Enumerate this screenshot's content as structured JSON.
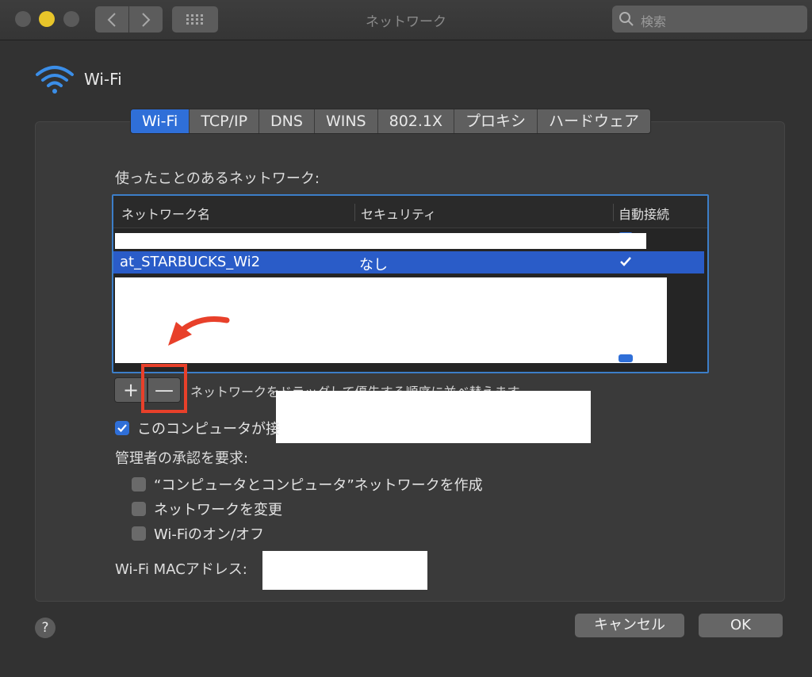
{
  "window": {
    "title": "ネットワーク",
    "search_placeholder": "検索"
  },
  "header": {
    "service_label": "Wi-Fi"
  },
  "tabs": [
    {
      "label": "Wi-Fi",
      "active": true
    },
    {
      "label": "TCP/IP",
      "active": false
    },
    {
      "label": "DNS",
      "active": false
    },
    {
      "label": "WINS",
      "active": false
    },
    {
      "label": "802.1X",
      "active": false
    },
    {
      "label": "プロキシ",
      "active": false
    },
    {
      "label": "ハードウェア",
      "active": false
    }
  ],
  "networks": {
    "section_label": "使ったことのあるネットワーク:",
    "columns": [
      "ネットワーク名",
      "セキュリティ",
      "自動接続"
    ],
    "selected_row": {
      "name": "at_STARBUCKS_Wi2",
      "security": "なし",
      "auto_join": true
    },
    "reorder_hint": "ネットワークをドラッグして優先する順序に並べ替えます",
    "plus_label": "+",
    "minus_label": "—"
  },
  "options": {
    "remember_label": "このコンピュータが接",
    "admin_label": "管理者の承認を要求:",
    "admin_items": [
      {
        "label": "“コンピュータとコンピュータ”ネットワークを作成",
        "checked": false
      },
      {
        "label": "ネットワークを変更",
        "checked": false
      },
      {
        "label": "Wi-Fiのオン/オフ",
        "checked": false
      }
    ],
    "mac_label": "Wi-Fi MACアドレス:"
  },
  "footer": {
    "help_label": "?",
    "cancel_label": "キャンセル",
    "ok_label": "OK"
  },
  "colors": {
    "accent": "#2f6fd8",
    "highlight": "#e8402a"
  }
}
